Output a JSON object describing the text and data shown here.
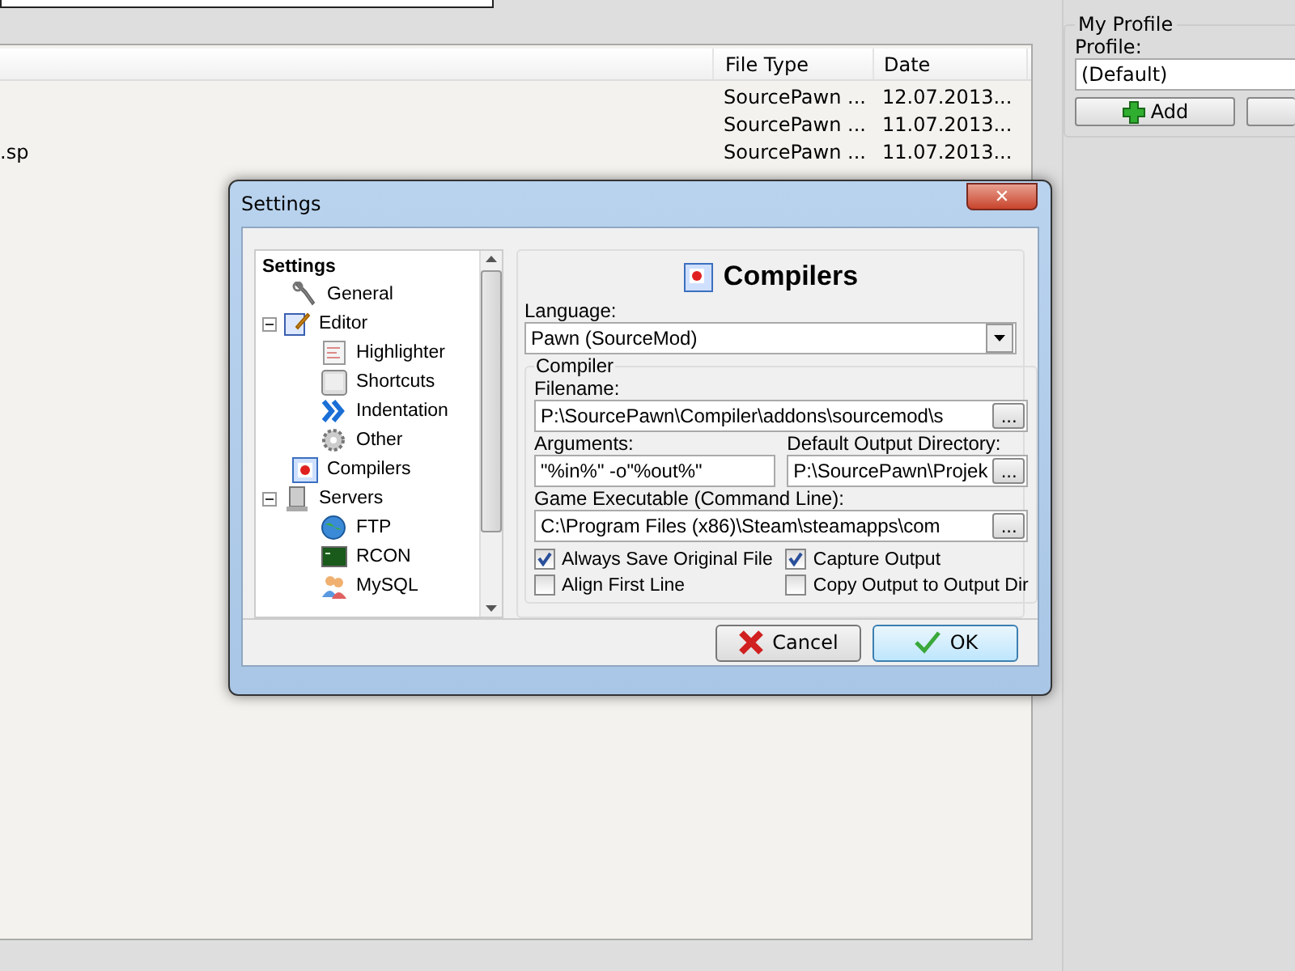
{
  "file_list": {
    "columns": [
      "File Type",
      "Date"
    ],
    "rows": [
      {
        "name": "",
        "type": "SourcePawn ...",
        "date": "12.07.2013..."
      },
      {
        "name": "",
        "type": "SourcePawn ...",
        "date": "11.07.2013..."
      },
      {
        "name": ".sp",
        "type": "SourcePawn ...",
        "date": "11.07.2013..."
      }
    ]
  },
  "profile_panel": {
    "title": "My Profile",
    "profile_label": "Profile:",
    "profile_value": "(Default)",
    "add_button": "Add"
  },
  "dialog": {
    "title": "Settings",
    "close": "✕",
    "tree": {
      "label": "Settings",
      "children": [
        {
          "label": "General",
          "selected": false
        },
        {
          "label": "Editor",
          "selected": false,
          "expanded": true,
          "children": [
            {
              "label": "Highlighter",
              "selected": false
            },
            {
              "label": "Shortcuts",
              "selected": false
            },
            {
              "label": "Indentation",
              "selected": false
            },
            {
              "label": "Other",
              "selected": false
            }
          ]
        },
        {
          "label": "Compilers",
          "selected": false
        },
        {
          "label": "Servers",
          "selected": false,
          "expanded": true,
          "children": [
            {
              "label": "FTP",
              "selected": false
            },
            {
              "label": "RCON",
              "selected": false
            },
            {
              "label": "MySQL",
              "selected": false
            }
          ]
        }
      ]
    },
    "page_title": "Compilers",
    "language_label": "Language:",
    "language_value": "Pawn (SourceMod)",
    "group_title": "Compiler",
    "filename_label": "Filename:",
    "filename_value": "P:\\SourcePawn\\Compiler\\addons\\sourcemod\\s",
    "arguments_label": "Arguments:",
    "arguments_value": "\"%in%\" -o\"%out%\"",
    "output_dir_label": "Default Output Directory:",
    "output_dir_value": "P:\\SourcePawn\\Projek",
    "game_label": "Game Executable (Command Line):",
    "game_value": "C:\\Program Files (x86)\\Steam\\steamapps\\com",
    "browse": "...",
    "checkboxes": [
      {
        "label": "Always Save Original File",
        "checked": true
      },
      {
        "label": "Capture Output",
        "checked": true
      },
      {
        "label": "Align First Line",
        "checked": false
      },
      {
        "label": "Copy Output to Output Dir",
        "checked": false
      }
    ],
    "buttons": [
      {
        "kind": "cancel",
        "label": "Cancel"
      },
      {
        "kind": "ok",
        "label": "OK"
      }
    ]
  }
}
